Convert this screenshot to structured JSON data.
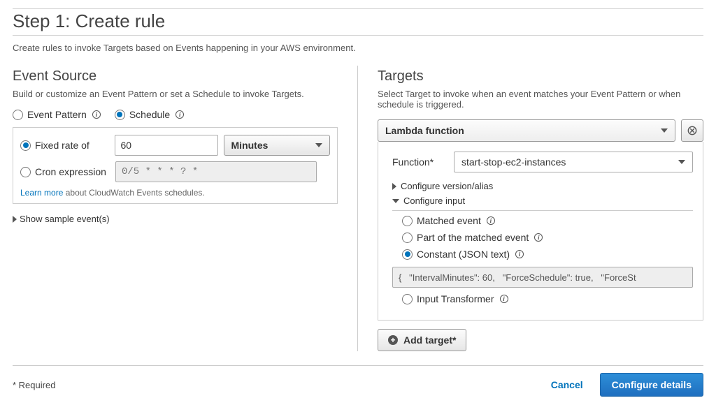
{
  "step": {
    "title": "Step 1: Create rule",
    "description": "Create rules to invoke Targets based on Events happening in your AWS environment."
  },
  "event_source": {
    "title": "Event Source",
    "description": "Build or customize an Event Pattern or set a Schedule to invoke Targets.",
    "mode": {
      "event_pattern_label": "Event Pattern",
      "schedule_label": "Schedule",
      "selected": "schedule"
    },
    "schedule": {
      "fixed_rate_label": "Fixed rate of",
      "rate_value": "60",
      "rate_unit": "Minutes",
      "cron_label": "Cron expression",
      "cron_placeholder": "0/5 * * * ? *",
      "selected": "fixed",
      "learn_more": "Learn more",
      "learn_tail": "about CloudWatch Events schedules."
    },
    "show_sample": "Show sample event(s)"
  },
  "targets": {
    "title": "Targets",
    "description": "Select Target to invoke when an event matches your Event Pattern or when schedule is triggered.",
    "target_type": "Lambda function",
    "function_label": "Function*",
    "function_value": "start-stop-ec2-instances",
    "configure_version": "Configure version/alias",
    "configure_input": "Configure input",
    "input_opts": {
      "matched": "Matched event",
      "partial": "Part of the matched event",
      "constant": "Constant (JSON text)",
      "transformer": "Input Transformer",
      "selected": "constant",
      "json_value": "{   \"IntervalMinutes\": 60,   \"ForceSchedule\": true,   \"ForceSt"
    },
    "add_target": "Add target*"
  },
  "footer": {
    "required": "* Required",
    "cancel": "Cancel",
    "configure": "Configure details"
  }
}
